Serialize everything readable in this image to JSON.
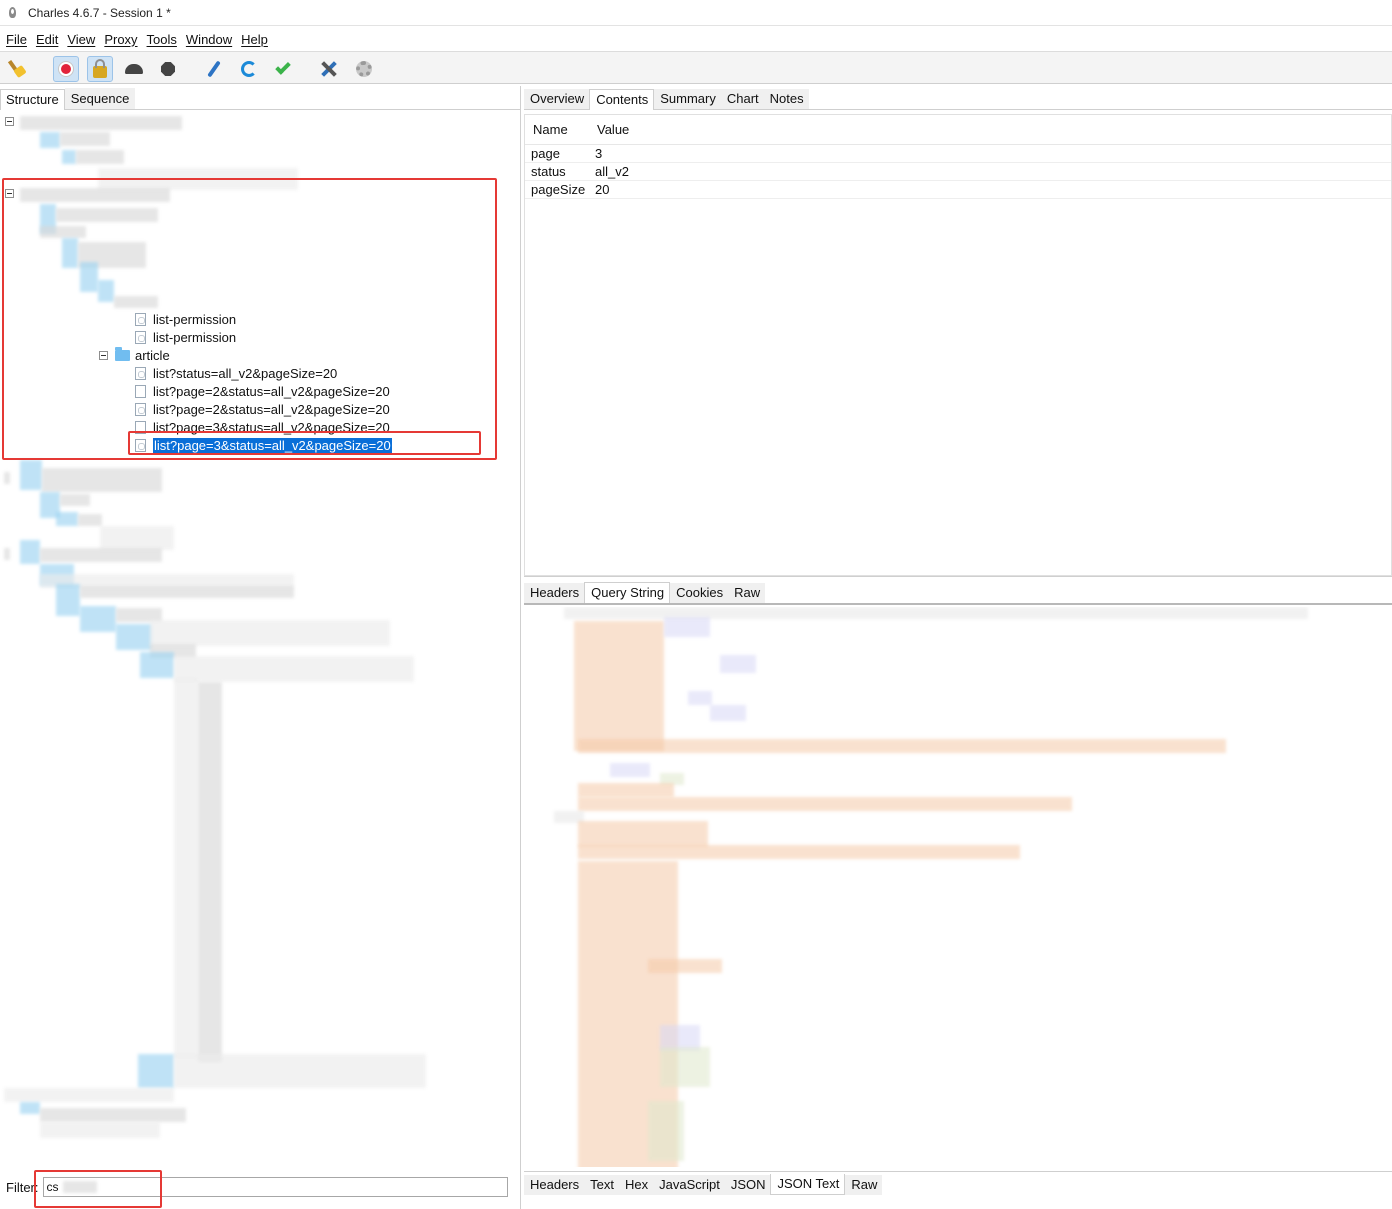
{
  "window": {
    "title": "Charles 4.6.7 - Session 1 *"
  },
  "menu": [
    "File",
    "Edit",
    "View",
    "Proxy",
    "Tools",
    "Window",
    "Help"
  ],
  "toolbar": {
    "icons": [
      "broom-icon",
      "record-icon",
      "ssl-lock-icon",
      "throttle-turtle-icon",
      "stop-icon",
      "compose-pen-icon",
      "repeat-refresh-icon",
      "validate-check-icon",
      "tools-icon",
      "settings-gear-icon"
    ]
  },
  "left_tabs": [
    "Structure",
    "Sequence"
  ],
  "tree": {
    "items": [
      {
        "label": "list-permission",
        "icon": "json-file-icon"
      },
      {
        "label": "list-permission",
        "icon": "json-file-icon"
      },
      {
        "label": "article",
        "icon": "folder-icon"
      },
      {
        "label": "list?status=all_v2&pageSize=20",
        "icon": "json-file-icon"
      },
      {
        "label": "list?page=2&status=all_v2&pageSize=20",
        "icon": "blank-file-icon"
      },
      {
        "label": "list?page=2&status=all_v2&pageSize=20",
        "icon": "json-file-icon"
      },
      {
        "label": "list?page=3&status=all_v2&pageSize=20",
        "icon": "blank-file-icon"
      },
      {
        "label": "list?page=3&status=all_v2&pageSize=20",
        "icon": "json-file-icon",
        "selected": true
      }
    ]
  },
  "filter": {
    "label": "Filter:",
    "value": "cs"
  },
  "right_tabs": [
    "Overview",
    "Contents",
    "Summary",
    "Chart",
    "Notes"
  ],
  "params_table": {
    "headers": [
      "Name",
      "Value"
    ],
    "rows": [
      {
        "name": "page",
        "value": "3"
      },
      {
        "name": "status",
        "value": "all_v2"
      },
      {
        "name": "pageSize",
        "value": "20"
      }
    ]
  },
  "request_tabs": [
    "Headers",
    "Query String",
    "Cookies",
    "Raw"
  ],
  "response_tabs": [
    "Headers",
    "Text",
    "Hex",
    "JavaScript",
    "JSON",
    "JSON Text",
    "Raw"
  ],
  "colors": {
    "selection": "#0a6fd8",
    "highlight_box": "#e53935"
  }
}
